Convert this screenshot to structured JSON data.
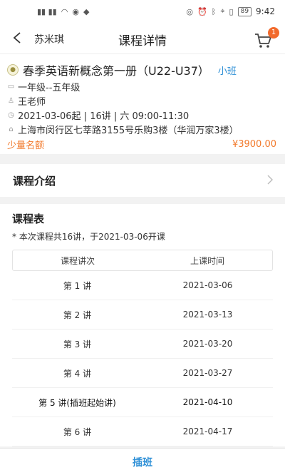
{
  "status_bar": {
    "signal_left": "⁴⁶ ⁴ᴳ ⁴ᴳ",
    "battery": "89",
    "time": "9:42"
  },
  "nav": {
    "user": "苏米琪",
    "title": "课程详情",
    "cart_count": "1"
  },
  "course": {
    "title": "春季英语新概念第一册（U22-U37）",
    "class_type": "小班",
    "grade": "一年级--五年级",
    "teacher": "王老师",
    "schedule": "2021-03-06起 | 16讲 | 六  09:00-11:30",
    "address": "上海市闵行区七莘路3155号乐购3楼（华润万家3楼）",
    "quota": "少量名额",
    "price": "¥3900.00"
  },
  "intro": {
    "label": "课程介绍"
  },
  "timetable": {
    "title": "课程表",
    "note": "* 本次课程共16讲，于2021-03-06开课",
    "headers": [
      "课程讲次",
      "上课时间"
    ],
    "rows": [
      {
        "lesson": "第 1 讲",
        "date": "2021-03-06"
      },
      {
        "lesson": "第 2 讲",
        "date": "2021-03-13"
      },
      {
        "lesson": "第 3 讲",
        "date": "2021-03-20"
      },
      {
        "lesson": "第 4 讲",
        "date": "2021-03-27"
      },
      {
        "lesson": "第 5 讲(插班起始讲)",
        "date": "2021-04-10"
      },
      {
        "lesson": "第 6 讲",
        "date": "2021-04-17"
      }
    ]
  },
  "bottom": {
    "cta": "插班"
  },
  "colors": {
    "accent": "#2d8fd6",
    "orange": "#f27a2c",
    "badge": "#f26a2c"
  }
}
